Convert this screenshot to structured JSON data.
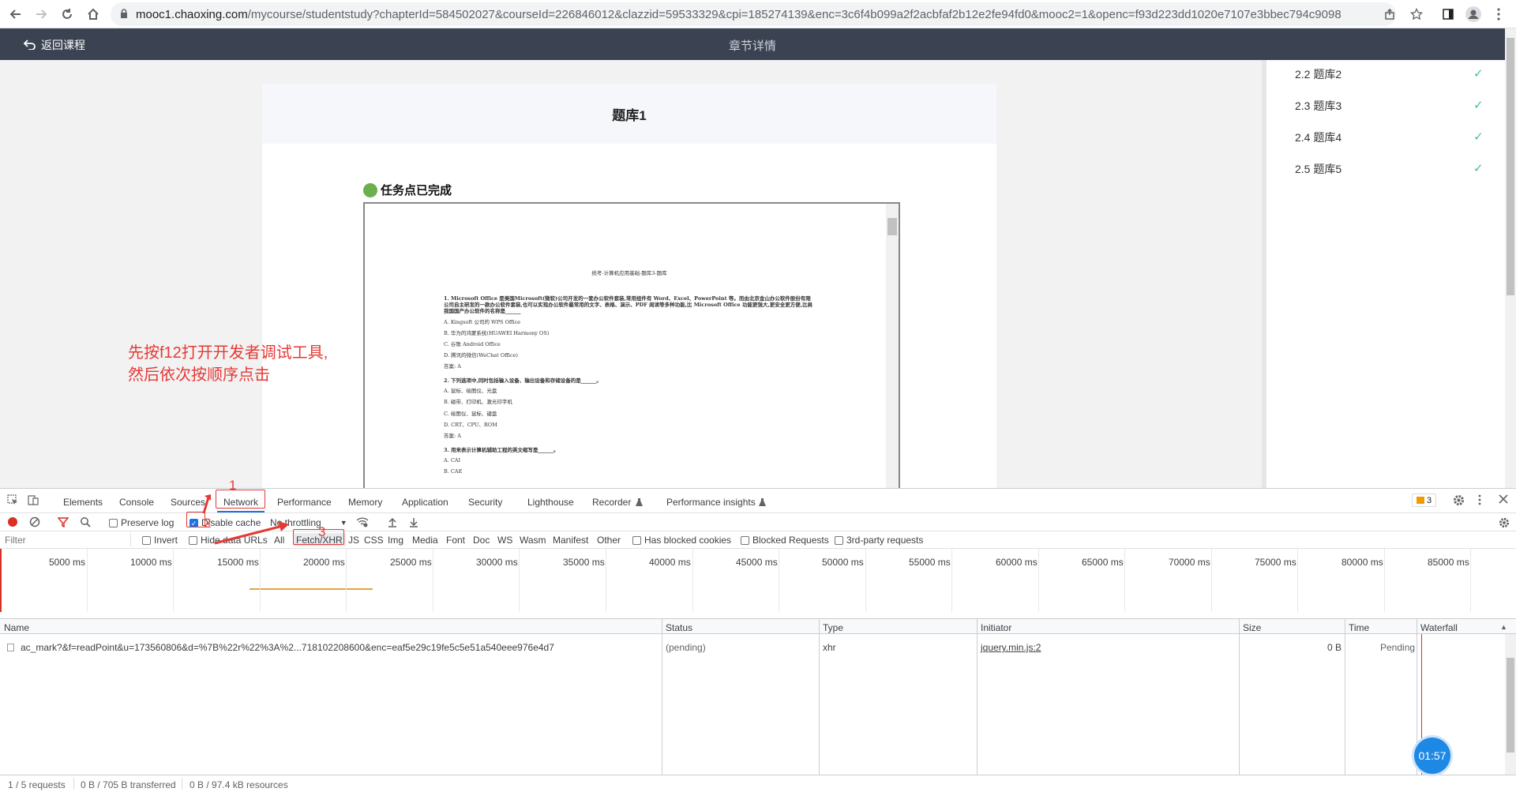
{
  "browser": {
    "url_host": "mooc1.chaoxing.com",
    "url_path": "/mycourse/studentstudy?chapterId=584502027&courseId=226846012&clazzid=59533329&cpi=185274139&enc=3c6f4b099a2f2acbfaf2b12e2fe94fd0&mooc2=1&openc=f93d223dd1020e7107e3bbec794c9098"
  },
  "header": {
    "back_label": "返回课程",
    "title": "章节详情"
  },
  "card": {
    "title": "题库1",
    "task_status": "任务点已完成",
    "doc": {
      "heading": "统考-计算机应用基础-题库3-题库",
      "q1": "1. Microsoft Office 是美国Microsoft(微软)公司开发的一套办公软件套装,常用组件有 Word、Excel、PowerPoint 等。而由北京金山办公软件股份有限公司自主研发的一款办公软件套装,也可以实现办公软件最常用的文字、表格、演示、PDF 阅读等多种功能,比 Microsoft Office 功能更强大,更安全更方便,比肩我国国产办公软件的名称是______",
      "q1a": "A. Kingsoft 公司的 WPS Office",
      "q1b": "B. 华为的鸿蒙系统(HUAWEI Harmony OS)",
      "q1c": "C. 谷歌 Android Office",
      "q1d": "D. 腾讯的微信(WeChat Office)",
      "q1ans": "答案: A",
      "q2": "2. 下列选项中,同时包括输入设备、输出设备和存储设备的是______。",
      "q2a": "A. 鼠标、绘图仪、光盘",
      "q2b": "B. 磁带、打印机、激光印字机",
      "q2c": "C. 绘图仪、鼠标、键盘",
      "q2d": "D. CRT、CPU、ROM",
      "q2ans": "答案: A",
      "q3": "3. 用来表示计算机辅助工程的英文缩写是______。",
      "q3a": "A. CAI",
      "q3b": "B. CAE"
    }
  },
  "sidebar": {
    "items": [
      {
        "label": "2.2 题库2"
      },
      {
        "label": "2.3 题库3"
      },
      {
        "label": "2.4 题库4"
      },
      {
        "label": "2.5 题库5"
      }
    ],
    "check_icon": "✓"
  },
  "annotation": {
    "line1": "先按f12打开开发者调试工具,",
    "line2": "然后依次按顺序点击",
    "n1": "1",
    "n2": "2",
    "n3": "3"
  },
  "devtools": {
    "tabs": [
      "Elements",
      "Console",
      "Sources",
      "Network",
      "Performance",
      "Memory",
      "Application",
      "Security",
      "Lighthouse",
      "Recorder",
      "Performance insights"
    ],
    "issues_count": "3",
    "preserve_log": "Preserve log",
    "disable_cache": "Disable cache",
    "throttling": "No throttling",
    "filter_placeholder": "Filter",
    "invert": "Invert",
    "hide_data_urls": "Hide data URLs",
    "types": [
      "All",
      "Fetch/XHR",
      "JS",
      "CSS",
      "Img",
      "Media",
      "Font",
      "Doc",
      "WS",
      "Wasm",
      "Manifest",
      "Other"
    ],
    "has_blocked_cookies": "Has blocked cookies",
    "blocked_requests": "Blocked Requests",
    "third_party": "3rd-party requests",
    "ticks": [
      "5000 ms",
      "10000 ms",
      "15000 ms",
      "20000 ms",
      "25000 ms",
      "30000 ms",
      "35000 ms",
      "40000 ms",
      "45000 ms",
      "50000 ms",
      "55000 ms",
      "60000 ms",
      "65000 ms",
      "70000 ms",
      "75000 ms",
      "80000 ms",
      "85000 ms"
    ],
    "columns": {
      "name": "Name",
      "status": "Status",
      "type": "Type",
      "initiator": "Initiator",
      "size": "Size",
      "time": "Time",
      "waterfall": "Waterfall"
    },
    "row": {
      "name": "ac_mark?&f=readPoint&u=173560806&d=%7B%22r%22%3A%2...718102208600&enc=eaf5e29c19fe5c5e51a540eee976e4d7",
      "status": "(pending)",
      "type": "xhr",
      "initiator": "jquery.min.js:2",
      "size": "0 B",
      "time": "Pending"
    },
    "status": {
      "requests": "1 / 5 requests",
      "transferred": "0 B / 705 B transferred",
      "resources": "0 B / 97.4 kB resources"
    }
  },
  "timer": "01:57"
}
